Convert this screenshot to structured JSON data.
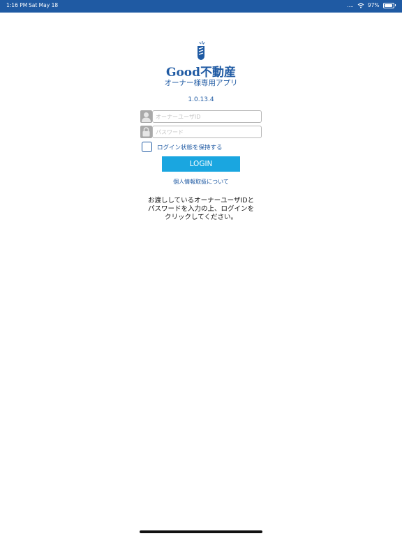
{
  "status_bar": {
    "time": "1:16 PM",
    "date": "Sat May 18",
    "signal": "....",
    "battery_percent": "97%",
    "battery_level": 0.97
  },
  "logo": {
    "brand": "Good不動産",
    "subtitle": "オーナー様専用アプリ",
    "color": "#1f5aa3"
  },
  "version": "1.0.13.4",
  "login_form": {
    "user_id": {
      "placeholder": "オーナーユーザID",
      "value": "",
      "icon": "user-icon"
    },
    "password": {
      "placeholder": "パスワード",
      "value": "",
      "icon": "lock-icon"
    },
    "remember_label": "ログイン状態を保持する",
    "remember_checked": false,
    "login_button": "LOGIN",
    "login_button_color": "#1aa6e0"
  },
  "privacy_link": "個人情報取扱について",
  "notice_lines": [
    "お渡ししているオーナーユーザIDと",
    "パスワードを入力の上、ログインを",
    "クリックしてください。"
  ]
}
